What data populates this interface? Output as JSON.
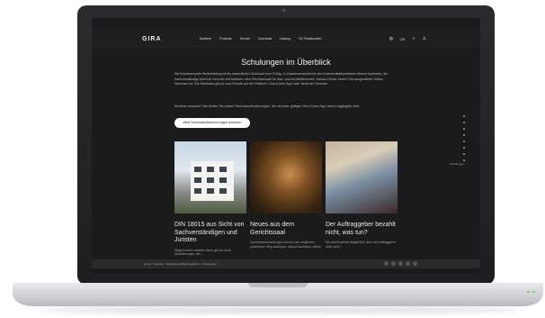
{
  "nav": {
    "logo": "GIRA",
    "menu": [
      "Systeme",
      "Produkte",
      "Service",
      "Download",
      "Katalog",
      "Für Privatkunden"
    ],
    "lang": "DE"
  },
  "page": {
    "title": "Schulungen im Überblick",
    "intro": "Die branchenweite Weiterbildung ist ein wesentlicher Schlüssel zum Erfolg. In Zusammenarbeit mit den Kommunikationstrainer Marcel Auerbach, der Sachverständige Ulbrecht Jevendt und weiteren, dem Rechtsanwalt für Bau- und Architektenrecht, Markus Decke, bietet Gira ausgewählte Online-Seminare an. Die Seminare gibt es zum Erwerb auf der Plattform ‚Gira Komm App‘ oder direkt am Seminar.",
    "note": "Seminar verpasst? Hier finden Sie unsere Seminaraufzeichnungen, die mit einer gültigen Gira Komm App Lizenz zugänglich sind.",
    "cta": "Jetzt Seminaraufzeichnungen ansehen"
  },
  "cards": [
    {
      "title": "DIN 18015 aus Sicht von Sachverständigen und Juristen",
      "text": "Wegen immer weiterer Norm gibt es neue Anforderungen, die ..."
    },
    {
      "title": "Neues aus dem Gerichtssaal",
      "text": "Gerichtsentscheidungen können den möglichen juristischen Weg aufzeigen. Marcel Auerbach, selbst ..."
    },
    {
      "title": "Der Auftraggeber bezahlt nicht, was tun?",
      "text": "Die Arbeit perfekt abgeliefert, doch der Auftraggeber zahlt nicht ..."
    }
  ],
  "side_label": "Schulungen",
  "breadcrumb": "Home > Service > Fachpartner/Planungshilfen > Schulungen"
}
